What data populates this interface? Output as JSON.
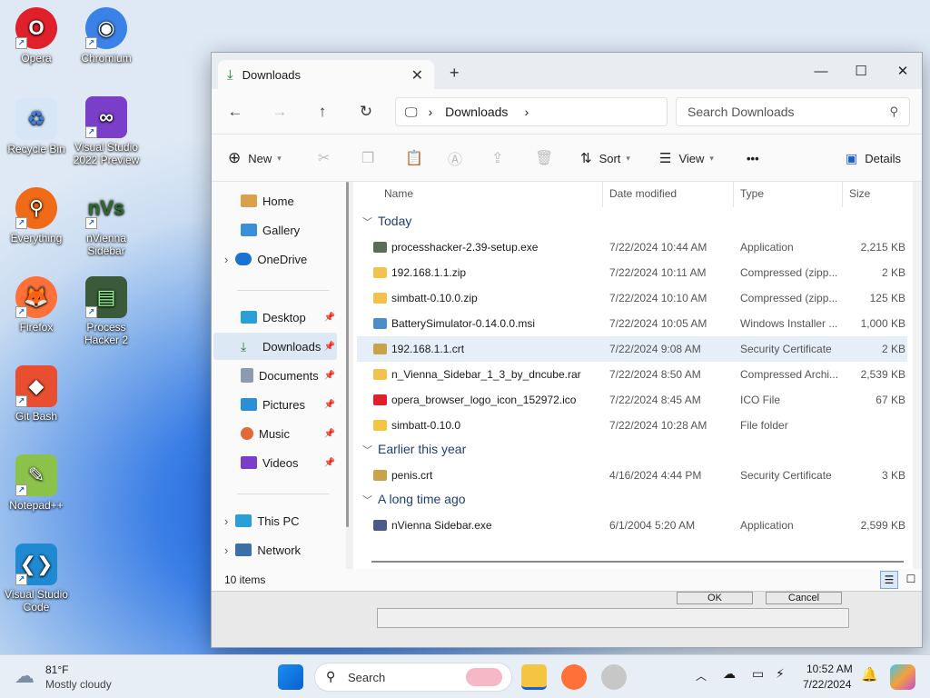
{
  "desktop": {
    "icons": [
      {
        "label": "Opera",
        "icon": "opera-icon",
        "color": "#e0202a"
      },
      {
        "label": "Chromium",
        "icon": "chromium-icon",
        "color": "#3b82e8"
      },
      {
        "label": "Recycle Bin",
        "icon": "recycle-bin-icon",
        "color": "#d7e6f7"
      },
      {
        "label": "Visual Studio 2022 Preview",
        "icon": "visual-studio-preview-icon",
        "color": "#7a3ec8"
      },
      {
        "label": "Everything",
        "icon": "everything-icon",
        "color": "#f06a18"
      },
      {
        "label": "nVienna Sidebar",
        "icon": "nvienna-icon",
        "color": "#2d6a2f"
      },
      {
        "label": "Firefox",
        "icon": "firefox-icon",
        "color": "#ff7139"
      },
      {
        "label": "Process Hacker 2",
        "icon": "process-hacker-icon",
        "color": "#3a5a3a"
      },
      {
        "label": "Git Bash",
        "icon": "git-bash-icon",
        "color": "#e94e31"
      },
      {
        "label": "Notepad++",
        "icon": "notepadpp-icon",
        "color": "#8bc34a"
      },
      {
        "label": "Visual Studio Code",
        "icon": "vscode-icon",
        "color": "#1f8ad2"
      }
    ]
  },
  "explorer": {
    "tab_title": "Downloads",
    "breadcrumb": "Downloads",
    "search_placeholder": "Search Downloads",
    "commands": {
      "new": "New",
      "sort": "Sort",
      "view": "View",
      "more": "•••",
      "details": "Details"
    },
    "nav": {
      "home": "Home",
      "gallery": "Gallery",
      "onedrive": "OneDrive",
      "desktop": "Desktop",
      "downloads": "Downloads",
      "documents": "Documents",
      "pictures": "Pictures",
      "music": "Music",
      "videos": "Videos",
      "thispc": "This PC",
      "network": "Network"
    },
    "columns": {
      "name": "Name",
      "date": "Date modified",
      "type": "Type",
      "size": "Size"
    },
    "groups": {
      "today": "Today",
      "earlier": "Earlier this year",
      "longago": "A long time ago"
    },
    "rows": [
      {
        "name": "processhacker-2.39-setup.exe",
        "date": "7/22/2024 10:44 AM",
        "type": "Application",
        "size": "2,215 KB",
        "color": "#5a6b5a"
      },
      {
        "name": "192.168.1.1.zip",
        "date": "7/22/2024 10:11 AM",
        "type": "Compressed (zipp...",
        "size": "2 KB",
        "color": "#f2c14e"
      },
      {
        "name": "simbatt-0.10.0.zip",
        "date": "7/22/2024 10:10 AM",
        "type": "Compressed (zipp...",
        "size": "125 KB",
        "color": "#f2c14e"
      },
      {
        "name": "BatterySimulator-0.14.0.0.msi",
        "date": "7/22/2024 10:05 AM",
        "type": "Windows Installer ...",
        "size": "1,000 KB",
        "color": "#4a8fc9"
      },
      {
        "name": "192.168.1.1.crt",
        "date": "7/22/2024 9:08 AM",
        "type": "Security Certificate",
        "size": "2 KB",
        "color": "#c9a24a"
      },
      {
        "name": "n_Vienna_Sidebar_1_3_by_dncube.rar",
        "date": "7/22/2024 8:50 AM",
        "type": "Compressed Archi...",
        "size": "2,539 KB",
        "color": "#f2c14e"
      },
      {
        "name": "opera_browser_logo_icon_152972.ico",
        "date": "7/22/2024 8:45 AM",
        "type": "ICO File",
        "size": "67 KB",
        "color": "#e0202a"
      },
      {
        "name": "simbatt-0.10.0",
        "date": "7/22/2024 10:28 AM",
        "type": "File folder",
        "size": "",
        "color": "#f5c542"
      },
      {
        "name": "penis.crt",
        "date": "4/16/2024 4:44 PM",
        "type": "Security Certificate",
        "size": "3 KB",
        "color": "#c9a24a"
      },
      {
        "name": "nVienna Sidebar.exe",
        "date": "6/1/2004 5:20 AM",
        "type": "Application",
        "size": "2,599 KB",
        "color": "#4a5a8a"
      }
    ],
    "status": "10 items",
    "bg_buttons": {
      "ok": "OK",
      "cancel": "Cancel"
    }
  },
  "taskbar": {
    "temp": "81°F",
    "weather": "Mostly cloudy",
    "search": "Search",
    "time": "10:52 AM",
    "date": "7/22/2024"
  }
}
